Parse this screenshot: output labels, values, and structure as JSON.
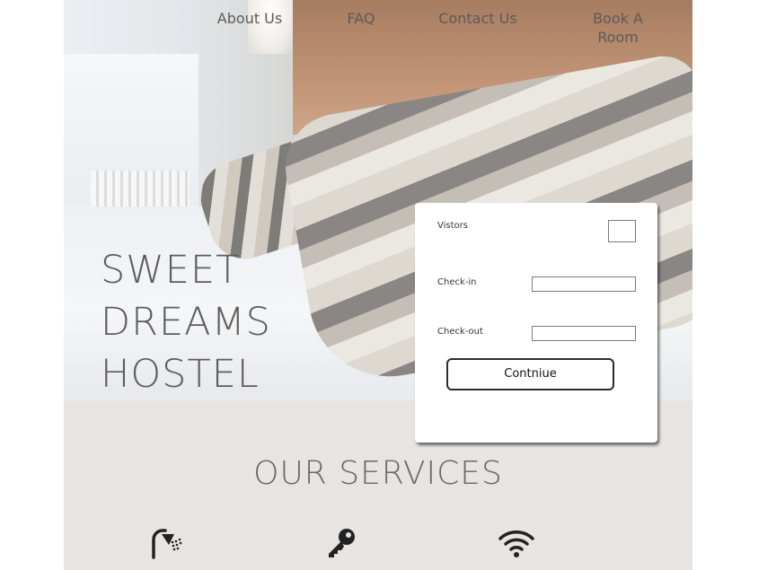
{
  "nav": {
    "items": [
      {
        "label": "About Us"
      },
      {
        "label": "FAQ"
      },
      {
        "label": "Contact Us"
      },
      {
        "label": "Book A Room"
      }
    ]
  },
  "hero": {
    "title_lines": [
      "SWEET",
      "DREAMS",
      "HOSTEL"
    ]
  },
  "booking": {
    "visitors_label": "Vistors",
    "visitors_value": "",
    "checkin_label": "Check-in",
    "checkin_value": "",
    "checkout_label": "Check-out",
    "checkout_value": "",
    "continue_label": "Contniue"
  },
  "services": {
    "title": "OUR SERVICES",
    "icons": [
      "shower-icon",
      "key-icon",
      "wifi-icon"
    ]
  },
  "colors": {
    "services_bg": "#e8e4e2",
    "title_text": "#5f5c5b",
    "nav_text": "#5e5a57"
  }
}
